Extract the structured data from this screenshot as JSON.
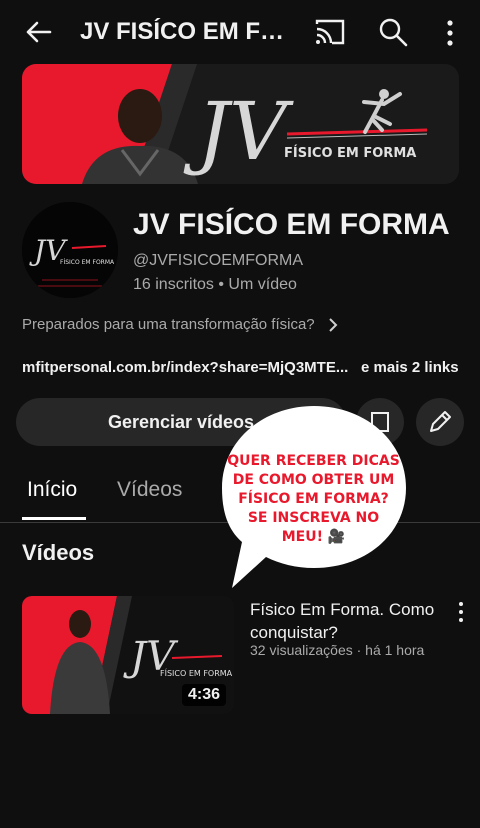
{
  "header": {
    "title": "JV FISÍCO EM FORMA",
    "icons": [
      "back-arrow-icon",
      "cast-icon",
      "search-icon",
      "more-vert-icon"
    ]
  },
  "banner": {
    "logo_text": "JV",
    "subtitle": "FÍSICO EM FORMA"
  },
  "avatar": {
    "logo_text": "JV",
    "subtitle": "FÍSICO EM FORMA"
  },
  "channel": {
    "name": "JV FISÍCO EM FORMA",
    "handle": "@JVFISICOEMFORMA",
    "stats": "16 inscritos • Um vídeo",
    "description": "Preparados para uma transformação física?",
    "link": "mfitpersonal.com.br/index?share=MjQ3MTE...",
    "more_links": "e mais 2 links"
  },
  "actions": {
    "manage_label": "Gerenciar vídeos"
  },
  "tabs": [
    {
      "label": "Início",
      "active": true
    },
    {
      "label": "Vídeos",
      "active": false
    }
  ],
  "section": {
    "title": "Vídeos"
  },
  "video": {
    "title": "Físico Em Forma. Como conquistar?",
    "meta": "32 visualizações · há 1 hora",
    "duration": "4:36",
    "thumb_logo": "JV",
    "thumb_subtitle": "FÍSICO EM FORMA"
  },
  "overlay_bubble": {
    "text": "QUER RECEBER DICAS DE COMO OBTER UM FÍSICO EM FORMA? SE INSCREVA NO MEU! 🎥"
  },
  "colors": {
    "background": "#0f0f0f",
    "brand_red": "#e8192c",
    "button_bg": "#272727"
  }
}
